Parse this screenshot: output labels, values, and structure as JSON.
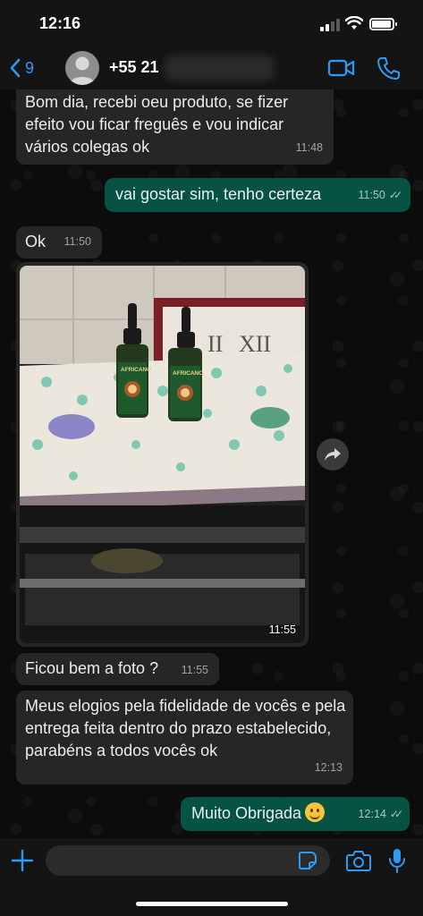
{
  "status_bar": {
    "time": "12:16"
  },
  "header": {
    "back_count": "9",
    "contact_name": "+55 21"
  },
  "messages": [
    {
      "direction": "in",
      "text": "Bom dia, recebi oeu produto, se fizer efeito vou ficar freguês e vou indicar vários colegas ok",
      "time": "11:48"
    },
    {
      "direction": "out",
      "text": "vai gostar sim, tenho certeza",
      "time": "11:50",
      "status": "read"
    },
    {
      "direction": "in",
      "text": "Ok",
      "time": "11:50"
    },
    {
      "direction": "in",
      "type": "photo",
      "time": "11:55",
      "bottle_label": "AFRICANO"
    },
    {
      "direction": "in",
      "text": "Ficou bem a foto ?",
      "time": "11:55"
    },
    {
      "direction": "in",
      "text": "Meus elogios pela fidelidade de vocês e pela entrega feita dentro do prazo estabelecido, parabéns a todos vocês ok",
      "time": "12:13"
    },
    {
      "direction": "out",
      "text": "Muito Obrigada",
      "emoji": "smiling-face",
      "time": "12:14",
      "status": "read"
    }
  ],
  "input": {
    "value": "",
    "placeholder": ""
  },
  "colors": {
    "accent": "#2b9bf4",
    "incoming_bubble": "#262626",
    "outgoing_bubble": "#065343",
    "background": "#0c0c0c"
  },
  "icons": [
    "back-chevron-icon",
    "avatar-placeholder-icon",
    "video-call-icon",
    "phone-icon",
    "forward-icon",
    "plus-icon",
    "sticker-icon",
    "camera-icon",
    "microphone-icon",
    "read-ticks-icon"
  ]
}
